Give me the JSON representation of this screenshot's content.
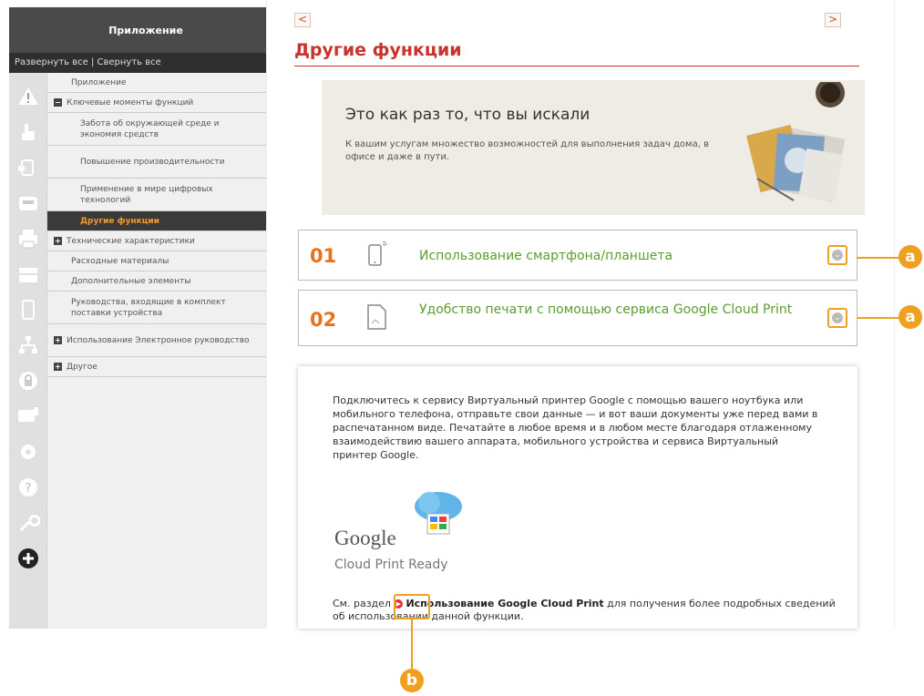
{
  "sidebar": {
    "title": "Приложение",
    "expand_collapse": "Развернуть все | Свернуть все",
    "rail_icons": [
      "warning-icon",
      "hand-pointer-icon",
      "device-screen-icon",
      "fax-icon",
      "printer-icon",
      "scanner-icon",
      "mobile-device-icon",
      "network-icon",
      "lock-icon",
      "display-icon",
      "settings-gear-icon",
      "help-icon",
      "wrench-icon",
      "plus-circle-icon"
    ],
    "items": [
      {
        "label": "Приложение",
        "level": 1,
        "box": ""
      },
      {
        "label": "Ключевые моменты функций",
        "level": 1,
        "box": "-"
      },
      {
        "label": "Забота об окружающей среде и экономия средств",
        "level": 2,
        "box": ""
      },
      {
        "label": "Повышение производительности",
        "level": 2,
        "box": ""
      },
      {
        "label": "Применение в мире цифровых технологий",
        "level": 2,
        "box": ""
      },
      {
        "label": "Другие функции",
        "level": 2,
        "box": "",
        "active": true
      },
      {
        "label": "Технические характеристики",
        "level": 1,
        "box": "+"
      },
      {
        "label": "Расходные материалы",
        "level": 1,
        "box": ""
      },
      {
        "label": "Дополнительные элементы",
        "level": 1,
        "box": ""
      },
      {
        "label": "Руководства, входящие в комплект поставки устройства",
        "level": 1,
        "box": ""
      },
      {
        "label": "Использование Электронное руководство",
        "level": 1,
        "box": "+"
      },
      {
        "label": "Другое",
        "level": 1,
        "box": "+"
      }
    ]
  },
  "nav": {
    "prev": "<",
    "next": ">"
  },
  "page_title": "Другие функции",
  "banner": {
    "heading": "Это как раз то, что вы искали",
    "text": "К вашим услугам множество возможностей для выполнения задач дома, в офисе и даже в пути."
  },
  "features": [
    {
      "num": "01",
      "label": "Использование смартфона/планшета",
      "icon": "smartphone-icon"
    },
    {
      "num": "02",
      "label": "Удобство печати с помощью сервиса Google Cloud Print",
      "icon": "document-print-icon"
    }
  ],
  "content": {
    "paragraph": "Подключитесь к сервису Виртуальный принтер Google с помощью вашего ноутбука или мобильного телефона, отправьте свои данные — и вот ваши документы уже перед вами в распечатанном виде. Печатайте в любое время и в любом месте благодаря отлаженному взаимодействию вашего аппарата, мобильного устройства и сервиса Виртуальный принтер Google.",
    "logo_google": "Google",
    "logo_ready": "Cloud Print Ready",
    "ref_prefix": "См. раздел",
    "ref_link": "Использование Google Cloud Print",
    "ref_suffix": "для получения более подробных сведений об использовании данной функции."
  },
  "callouts": {
    "a": "a",
    "b": "b"
  },
  "colors": {
    "accent_orange": "#f0a020",
    "title_red": "#c9332b",
    "feature_green": "#5a9e2e",
    "number_orange": "#e9711c"
  }
}
